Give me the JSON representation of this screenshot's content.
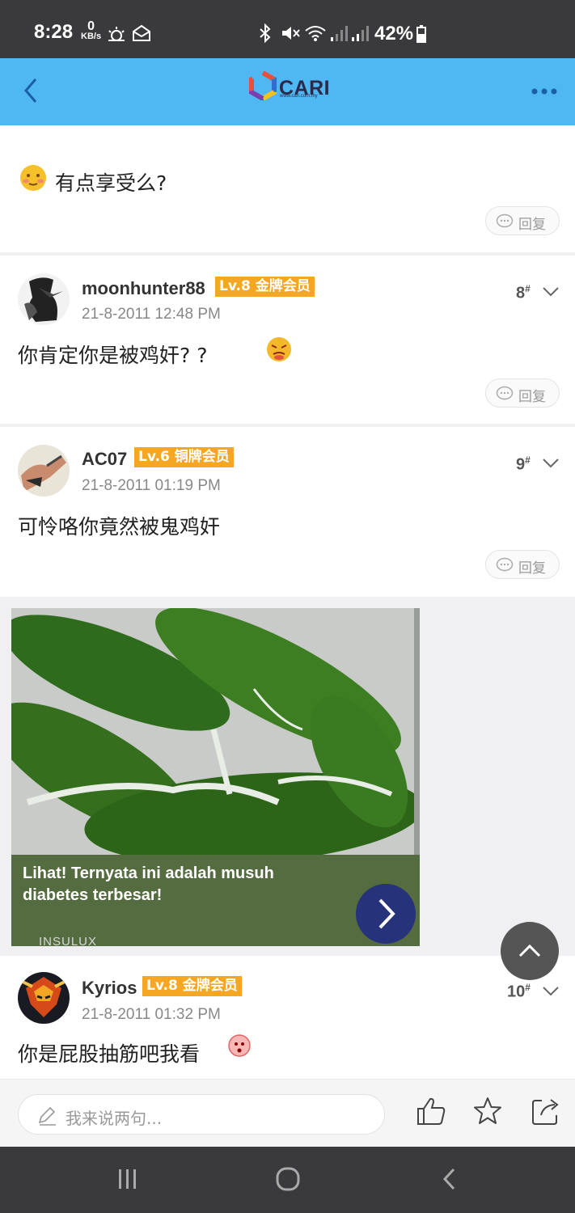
{
  "status_bar": {
    "time": "8:28",
    "net_speed_value": "0",
    "net_speed_unit": "KB/s",
    "battery": "42%"
  },
  "header": {
    "logo_text": "CARI",
    "logo_url": "www.cari.com.my"
  },
  "posts": [
    {
      "content": "有点享受么?",
      "reply_label": "回复"
    },
    {
      "username": "moonhunter88",
      "level": "Lv.8 金牌会员",
      "date": "21-8-2011 12:48 PM",
      "floor": "8",
      "content": "你肯定你是被鸡奸? ?",
      "reply_label": "回复"
    },
    {
      "username": "AC07",
      "level": "Lv.6 铜牌会员",
      "date": "21-8-2011 01:19 PM",
      "floor": "9",
      "content": "可怜咯你竟然被鬼鸡奸",
      "reply_label": "回复"
    },
    {
      "username": "Kyrios",
      "level": "Lv.8 金牌会员",
      "date": "21-8-2011 01:32 PM",
      "floor": "10",
      "content": "你是屁股抽筋吧我看"
    }
  ],
  "ad": {
    "caption": "Lihat! Ternyata ini adalah musuh diabetes terbesar!",
    "brand": "INSULUX"
  },
  "bottom_bar": {
    "input_placeholder": "我来说两句..."
  },
  "floor_suffix": "#",
  "colors": {
    "header_bg": "#4fb8f3",
    "badge": "#f5a623",
    "status_bar": "#3a3a3c"
  }
}
